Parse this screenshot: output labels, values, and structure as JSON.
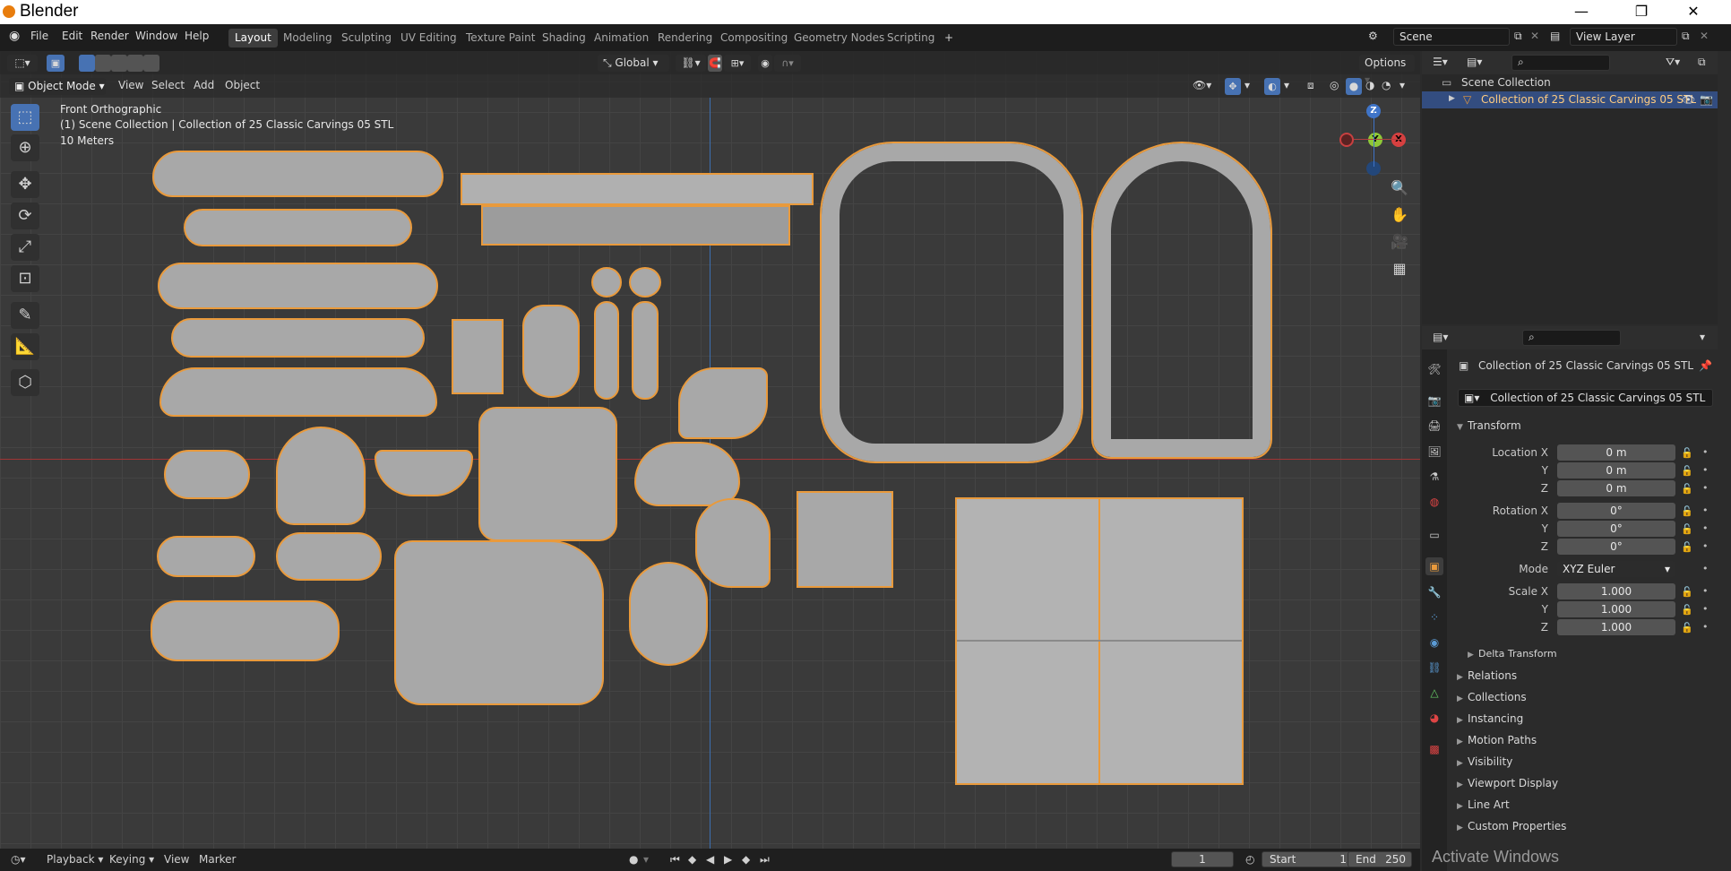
{
  "window": {
    "title": "Blender",
    "minimize": "—",
    "maximize": "❐",
    "close": "✕"
  },
  "menu": {
    "items": [
      "File",
      "Edit",
      "Render",
      "Window",
      "Help"
    ]
  },
  "workspaces": {
    "tabs": [
      "Layout",
      "Modeling",
      "Sculpting",
      "UV Editing",
      "Texture Paint",
      "Shading",
      "Animation",
      "Rendering",
      "Compositing",
      "Geometry Nodes",
      "Scripting"
    ],
    "active": "Layout",
    "add": "+"
  },
  "scene": {
    "name": "Scene",
    "view_layer": "View Layer"
  },
  "viewport": {
    "mode": "Object Mode",
    "menus": [
      "View",
      "Select",
      "Add",
      "Object"
    ],
    "orientation": "Global",
    "options": "Options",
    "view_name": "Front Orthographic",
    "collection_info": "(1) Scene Collection | Collection of 25 Classic Carvings 05 STL",
    "scale": "10 Meters",
    "gizmo": {
      "z": "Z",
      "y": "Y",
      "x": "X"
    }
  },
  "outliner": {
    "root": "Scene Collection",
    "child": "Collection of 25 Classic Carvings 05 STL"
  },
  "properties": {
    "object_name": "Collection of 25 Classic Carvings 05 STL",
    "data_name": "Collection of 25 Classic Carvings 05 STL",
    "transform": {
      "title": "Transform",
      "location_label": "Location X",
      "location": [
        "0 m",
        "0 m",
        "0 m"
      ],
      "rotation_label": "Rotation X",
      "rotation": [
        "0°",
        "0°",
        "0°"
      ],
      "mode_label": "Mode",
      "mode": "XYZ Euler",
      "scale_label": "Scale X",
      "scale": [
        "1.000",
        "1.000",
        "1.000"
      ],
      "y": "Y",
      "z": "Z"
    },
    "delta": "Delta Transform",
    "sections": [
      "Relations",
      "Collections",
      "Instancing",
      "Motion Paths",
      "Visibility",
      "Viewport Display",
      "Line Art",
      "Custom Properties"
    ]
  },
  "timeline": {
    "menus": [
      "Playback",
      "Keying",
      "View",
      "Marker"
    ],
    "current_frame": "1",
    "start_label": "Start",
    "start": "1",
    "end_label": "End",
    "end": "250"
  },
  "watermark": "Activate Windows",
  "colors": {
    "accent": "#4772b3",
    "selection": "#e99a3c",
    "x_axis": "#a03535",
    "z_axis": "#3c6fb0"
  }
}
